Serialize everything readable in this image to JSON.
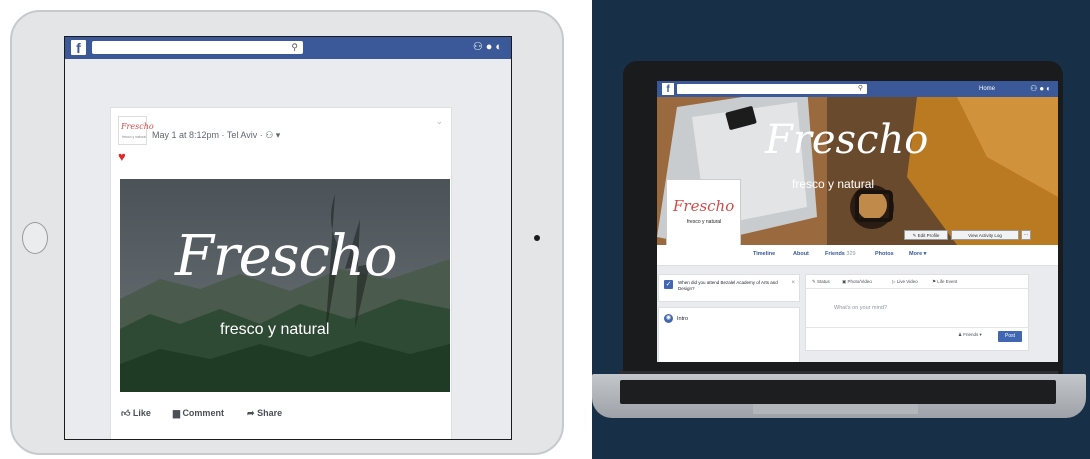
{
  "tablet": {
    "search_icon": "search-icon",
    "post": {
      "logo_text": "Frescho",
      "meta": "May 1 at 8:12pm · Tel Aviv · ⚇ ▾",
      "brand_name": "Frescho",
      "tagline": "fresco y natural",
      "actions": [
        {
          "icon": "like-icon",
          "label": "Like"
        },
        {
          "icon": "comment-icon",
          "label": "Comment"
        },
        {
          "icon": "share-icon",
          "label": "Share"
        }
      ]
    }
  },
  "laptop": {
    "nav_home": "Home",
    "cover_brand": "Frescho",
    "cover_tagline": "fresco y natural",
    "profile_name": "Frescho",
    "profile_sub": "fresco y natural",
    "buttons": {
      "edit": "✎ Edit Profile",
      "activity": "View Activity Log",
      "more": "···"
    },
    "tabs": [
      {
        "label": "Timeline",
        "count": ""
      },
      {
        "label": "About",
        "count": ""
      },
      {
        "label": "Friends",
        "count": "329"
      },
      {
        "label": "Photos",
        "count": ""
      },
      {
        "label": "More ▾",
        "count": ""
      }
    ],
    "question": "When did you attend Bezalel Academy of Arts and Design?",
    "intro_label": "Intro",
    "composer_tabs": [
      "✎ Status",
      "▣ Photo/Video",
      "▷ Live Video",
      "⚑ Life Event"
    ],
    "composer_placeholder": "What's on your mind?",
    "friends_label": "♟ Friends ▾",
    "post_label": "Post"
  },
  "colors": {
    "facebook_blue": "#3b5998",
    "background_navy": "#173048",
    "heart_red": "#e0282b"
  }
}
